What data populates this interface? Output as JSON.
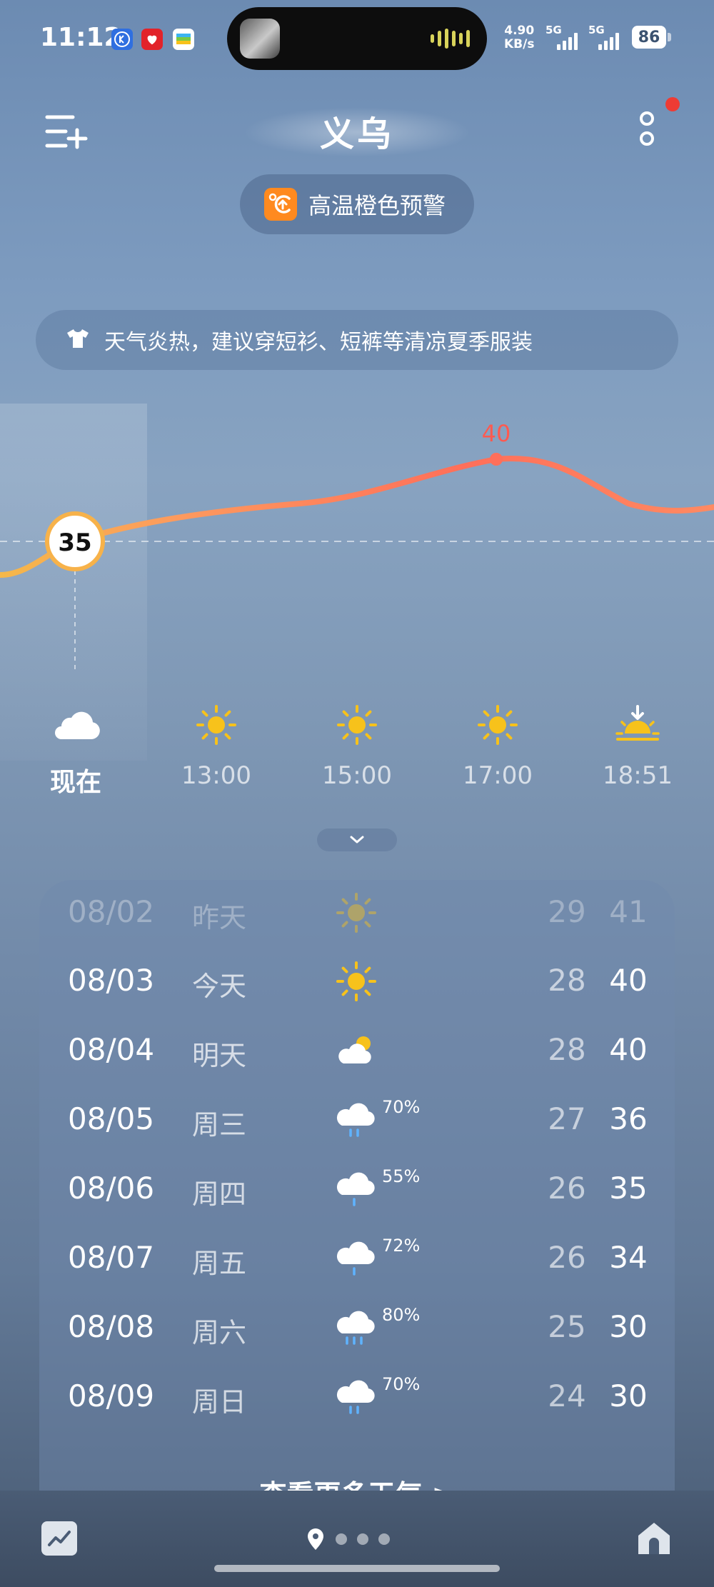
{
  "status_bar": {
    "time": "11:12",
    "net_speed_value": "4.90",
    "net_speed_unit": "KB/s",
    "sim1_label": "5G",
    "sim2_label": "5G",
    "battery": "86",
    "app_icons": [
      "k-app-icon",
      "heart-app-icon",
      "wallet-app-icon"
    ]
  },
  "header": {
    "city": "义乌",
    "alert": "高温橙色预警",
    "tip": "天气炎热，建议穿短衫、短裤等清凉夏季服装"
  },
  "hourly": {
    "current_temp": "35",
    "peak_temp": "40",
    "items": [
      {
        "label": "现在",
        "icon": "cloud-icon"
      },
      {
        "label": "13:00",
        "icon": "sun-icon"
      },
      {
        "label": "15:00",
        "icon": "sun-icon"
      },
      {
        "label": "17:00",
        "icon": "sun-icon"
      },
      {
        "label": "18:51",
        "icon": "sunset-icon"
      }
    ]
  },
  "daily": {
    "rows": [
      {
        "date": "08/02",
        "day": "昨天",
        "icon": "sun-icon",
        "precip": "",
        "low": "29",
        "high": "41"
      },
      {
        "date": "08/03",
        "day": "今天",
        "icon": "sun-icon",
        "precip": "",
        "low": "28",
        "high": "40"
      },
      {
        "date": "08/04",
        "day": "明天",
        "icon": "partly-cloudy-icon",
        "precip": "",
        "low": "28",
        "high": "40"
      },
      {
        "date": "08/05",
        "day": "周三",
        "icon": "rain-icon",
        "precip": "70%",
        "low": "27",
        "high": "36"
      },
      {
        "date": "08/06",
        "day": "周四",
        "icon": "rain-icon",
        "precip": "55%",
        "low": "26",
        "high": "35"
      },
      {
        "date": "08/07",
        "day": "周五",
        "icon": "rain-icon",
        "precip": "72%",
        "low": "26",
        "high": "34"
      },
      {
        "date": "08/08",
        "day": "周六",
        "icon": "heavy-rain-icon",
        "precip": "80%",
        "low": "25",
        "high": "30"
      },
      {
        "date": "08/09",
        "day": "周日",
        "icon": "rain-icon",
        "precip": "70%",
        "low": "24",
        "high": "30"
      }
    ],
    "more_link": "查看更多天气 >"
  },
  "colors": {
    "sun": "#f7c21b",
    "curve_start": "#f5b84a",
    "curve_end": "#ff6f5a",
    "peak_label": "#ff5a50",
    "alert_orange": "#ff8a1f"
  }
}
